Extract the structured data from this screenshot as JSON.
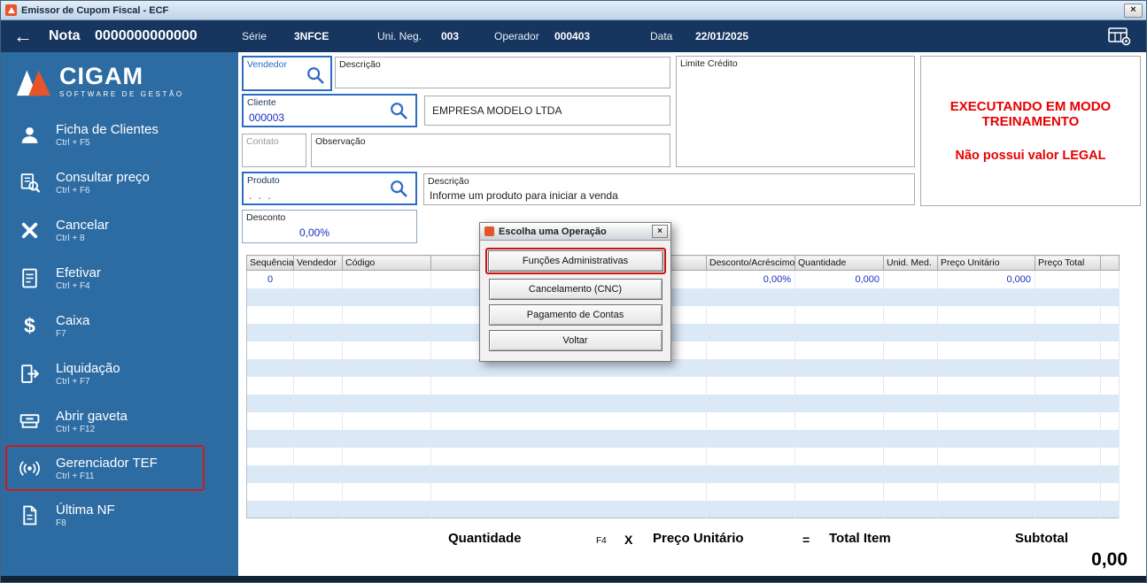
{
  "window": {
    "title": "Emissor de Cupom Fiscal - ECF",
    "close_label": "×"
  },
  "header": {
    "back": "←",
    "nota_label": "Nota",
    "nota_value": "0000000000000",
    "serie_label": "Série",
    "serie_value": "3NFCE",
    "unineg_label": "Uni. Neg.",
    "unineg_value": "003",
    "operador_label": "Operador",
    "operador_value": "000403",
    "data_label": "Data",
    "data_value": "22/01/2025"
  },
  "sidebar": {
    "brand": "CIGAM",
    "brand_tagline": "SOFTWARE DE GESTÃO",
    "items": [
      {
        "label": "Ficha de Clientes",
        "shortcut": "Ctrl + F5"
      },
      {
        "label": "Consultar preço",
        "shortcut": "Ctrl + F6"
      },
      {
        "label": "Cancelar",
        "shortcut": "Ctrl + 8"
      },
      {
        "label": "Efetivar",
        "shortcut": "Ctrl + F4"
      },
      {
        "label": "Caixa",
        "shortcut": "F7"
      },
      {
        "label": "Liquidação",
        "shortcut": "Ctrl + F7"
      },
      {
        "label": "Abrir gaveta",
        "shortcut": "Ctrl + F12"
      },
      {
        "label": "Gerenciador TEF",
        "shortcut": "Ctrl + F11"
      },
      {
        "label": "Última NF",
        "shortcut": "F8"
      }
    ]
  },
  "form": {
    "vendedor": {
      "label": "Vendedor"
    },
    "vendedor_descricao": {
      "label": "Descrição"
    },
    "limite_credito": {
      "label": "Limite Crédito"
    },
    "cliente": {
      "label": "Cliente",
      "value": "000003"
    },
    "cliente_nome": "EMPRESA MODELO LTDA",
    "contato": {
      "label": "Contato"
    },
    "observacao": {
      "label": "Observação"
    },
    "produto": {
      "label": "Produto",
      "value": ". . ."
    },
    "produto_descricao": {
      "label": "Descrição",
      "value": "Informe um produto para iniciar a venda"
    },
    "desconto": {
      "label": "Desconto",
      "value": "0,00%"
    }
  },
  "training": {
    "line1": "EXECUTANDO EM MODO TREINAMENTO",
    "line2": "Não possui valor LEGAL"
  },
  "table": {
    "columns": [
      "Sequência",
      "Vendedor",
      "Código",
      "",
      "Desconto/Acréscimo",
      "Quantidade",
      "Unid. Med.",
      "Preço Unitário",
      "Preço Total",
      ""
    ],
    "row0": {
      "sequencia": "0",
      "desconto_acrescimo": "0,00%",
      "quantidade": "0,000",
      "preco_unitario": "0,000"
    }
  },
  "dialog": {
    "title": "Escolha uma Operação",
    "close_label": "×",
    "buttons": [
      "Funções Administrativas",
      "Cancelamento (CNC)",
      "Pagamento de Contas",
      "Voltar"
    ]
  },
  "footer": {
    "quantidade": "Quantidade",
    "shortcut_f4": "F4",
    "times": "X",
    "preco_unitario": "Preço Unitário",
    "equals": "=",
    "total_item": "Total Item",
    "subtotal_label": "Subtotal",
    "subtotal_value": "0,00"
  },
  "colors": {
    "header_bg": "#17365f",
    "sidebar_bg": "#2d6ca3",
    "accent_red": "#c41414",
    "training_red": "#e80000",
    "field_border_blue": "#2b6cc4",
    "value_blue": "#1b2fbf",
    "row_alt": "#dbe9f7",
    "brand_orange": "#e8542a"
  }
}
